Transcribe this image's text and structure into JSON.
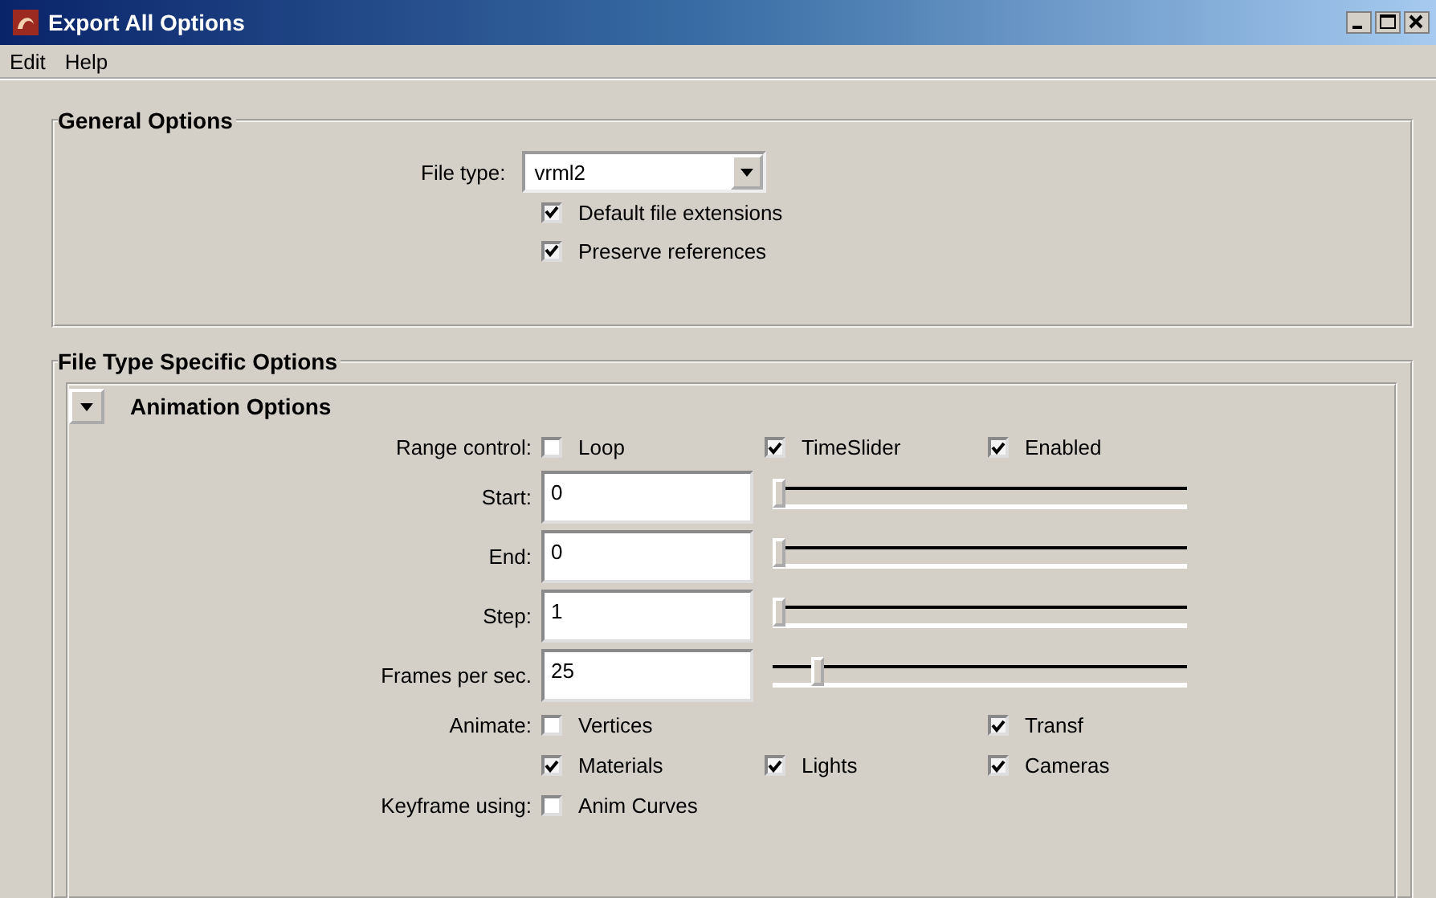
{
  "window": {
    "title": "Export All Options"
  },
  "menu": [
    "Edit",
    "Help"
  ],
  "general": {
    "title": "General Options",
    "file_type_label": "File type:",
    "file_type": "vrml2",
    "checks": [
      {
        "label": "Default file extensions",
        "checked": true
      },
      {
        "label": "Preserve references",
        "checked": true
      }
    ]
  },
  "specific": {
    "title": "File Type Specific Options",
    "section": {
      "title": "Animation Options",
      "expanded": true
    },
    "rows": [
      {
        "kind": "checks",
        "label": "Range control:",
        "cells": [
          {
            "kind": "check",
            "label": "Loop",
            "checked": false
          },
          {
            "kind": "check",
            "label": "TimeSlider",
            "checked": true
          },
          {
            "kind": "check",
            "label": "Enabled",
            "checked": true
          }
        ]
      },
      {
        "kind": "slider",
        "label": "Start:",
        "value": "0",
        "level": 0
      },
      {
        "kind": "slider",
        "label": "End:",
        "value": "0",
        "level": 0
      },
      {
        "kind": "slider",
        "label": "Step:",
        "value": "1",
        "level": 0
      },
      {
        "kind": "slider",
        "label": "Frames per sec.",
        "value": "25",
        "level": 0.1
      },
      {
        "kind": "checks",
        "label": "Animate:",
        "cells": [
          {
            "kind": "check",
            "label": "Vertices",
            "checked": false
          },
          {
            "kind": "gap"
          },
          {
            "kind": "check",
            "label": "Transf",
            "checked": true
          }
        ]
      },
      {
        "kind": "checks",
        "cells": [
          {
            "kind": "check",
            "label": "Materials",
            "checked": true
          },
          {
            "kind": "check",
            "label": "Lights",
            "checked": true
          },
          {
            "kind": "check",
            "label": "Cameras",
            "checked": true
          }
        ]
      },
      {
        "kind": "checks",
        "label": "Keyframe using:",
        "cells": [
          {
            "kind": "check",
            "label": "Anim Curves",
            "checked": false
          }
        ]
      }
    ]
  }
}
